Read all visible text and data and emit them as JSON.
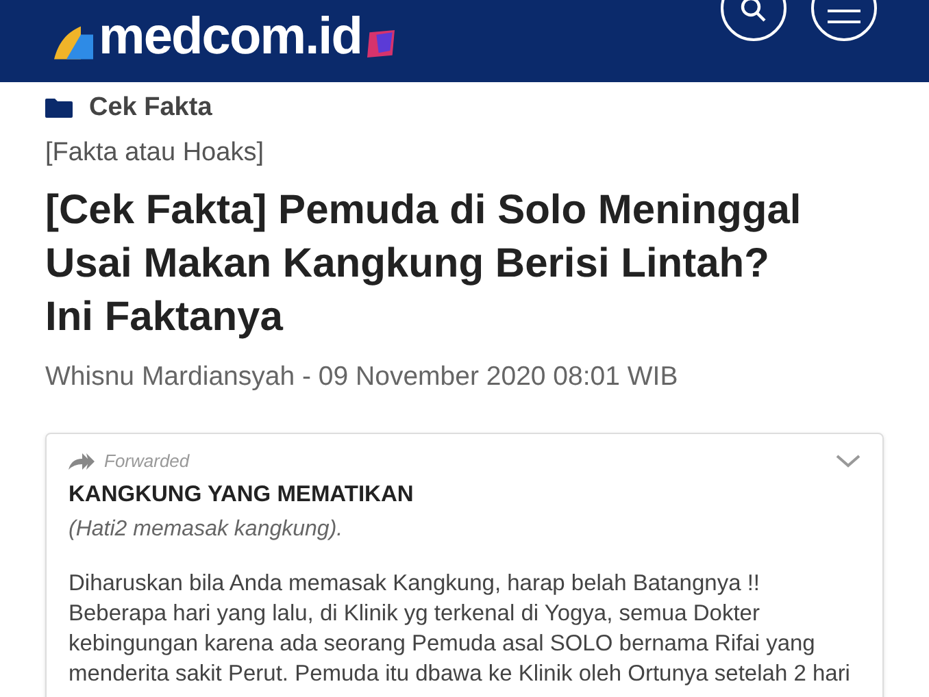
{
  "header": {
    "logo": "medcom.id"
  },
  "category": "Cek Fakta",
  "subcategory": "[Fakta atau Hoaks]",
  "title": "[Cek Fakta] Pemuda di Solo Meninggal Usai Makan Kangkung Berisi Lintah? Ini Faktanya",
  "byline": "Whisnu Mardiansyah - 09 November 2020 08:01 WIB",
  "message": {
    "forwarded": "Forwarded",
    "heading": "KANGKUNG YANG MEMATIKAN",
    "subheading": "(Hati2 memasak kangkung).",
    "lines": [
      "Diharuskan bila Anda memasak Kangkung, harap belah Batangnya !!",
      "Beberapa hari yang lalu, di Klinik yg terkenal di Yogya, semua Dokter",
      "kebingungan karena ada seorang Pemuda asal SOLO bernama Rifai yang",
      "menderita sakit Perut. Pemuda itu dbawa ke Klinik oleh Ortunya setelah 2 hari"
    ]
  }
}
